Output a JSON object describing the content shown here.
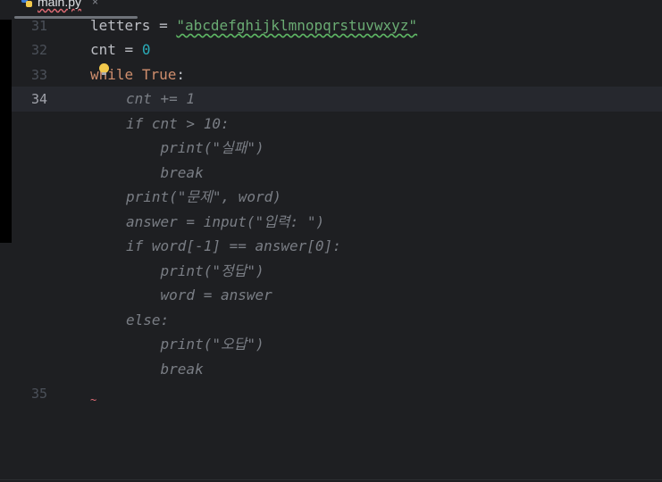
{
  "tab": {
    "filename": "main.py",
    "close_icon": "×"
  },
  "line_numbers": {
    "l31": "31",
    "l32": "32",
    "l33": "33",
    "l34": "34",
    "l35": "35"
  },
  "code": {
    "letters_var": "letters",
    "letters_eq": " = ",
    "letters_value": "\"abcdefghijklmnopqrstuvwxyz\"",
    "cnt_var": "cnt",
    "cnt_eq": " = ",
    "cnt_value": "0",
    "while_kw": "while",
    "while_space": " ",
    "true_kw": "True",
    "colon": ":",
    "inner": [
      "cnt += 1",
      "if cnt > 10:",
      "    print(\"실패\")",
      "    break",
      "print(\"문제\", word)",
      "answer = input(\"입력: \")",
      "if word[-1] == answer[0]:",
      "    print(\"정답\")",
      "    word = answer",
      "else:",
      "    print(\"오답\")",
      "    break"
    ],
    "error_marker": "~"
  }
}
